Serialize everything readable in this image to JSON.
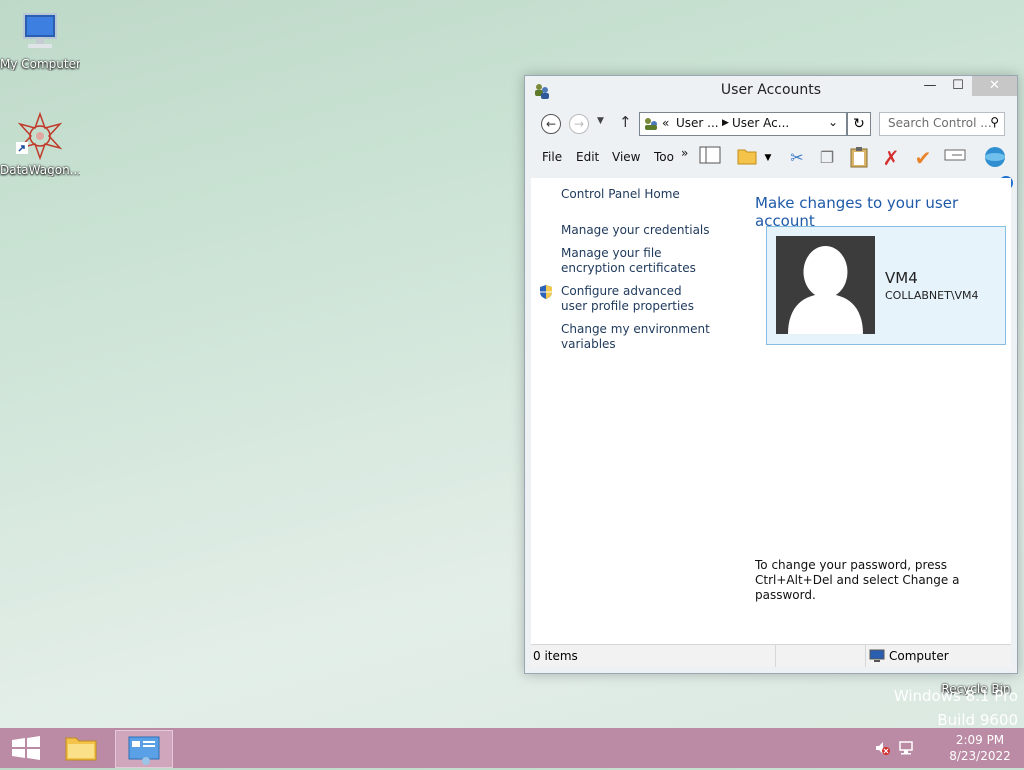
{
  "desktop": {
    "icons": [
      {
        "label": "My Computer"
      },
      {
        "label": "DataWagon..."
      },
      {
        "label": "Recycle Bin"
      }
    ],
    "watermark": {
      "line1": "Windows 8.1 Pro",
      "line2": "Build 9600"
    }
  },
  "window": {
    "title": "User Accounts",
    "controls": {
      "minimize": "—",
      "maximize": "☐",
      "close": "✕"
    },
    "address": {
      "prefix": "«",
      "crumb1": "User ...",
      "crumb2": "User Ac..."
    },
    "search": {
      "placeholder": "Search Control ..."
    },
    "menu": {
      "file": "File",
      "edit": "Edit",
      "view": "View",
      "tools": "Too",
      "more": "»"
    },
    "sidebar": {
      "home": "Control Panel Home",
      "links": [
        "Manage your credentials",
        "Manage your file encryption certificates",
        "Configure advanced user profile properties",
        "Change my environment variables"
      ]
    },
    "main": {
      "heading": "Make changes to your user account",
      "account": {
        "name": "VM4",
        "domain": "COLLABNET\\VM4"
      },
      "password_note": "To change your password, press Ctrl+Alt+Del and select Change a password."
    },
    "status": {
      "items": "0 items",
      "location": "Computer"
    }
  },
  "taskbar": {
    "time": "2:09 PM",
    "date": "8/23/2022"
  },
  "colors": {
    "taskbar": "#bb8aa4",
    "link": "#1e395b",
    "heading": "#1e5aa8",
    "card": "#e6f3fb"
  }
}
